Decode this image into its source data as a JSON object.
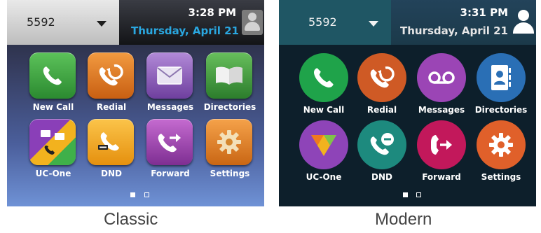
{
  "classic": {
    "line": "5592",
    "time": "3:28 PM",
    "date": "Thursday, April 21",
    "caption": "Classic",
    "colors": {
      "date": "#2aa7e0"
    },
    "apps": [
      {
        "label": "New Call",
        "icon": "phone-icon",
        "color": "#3aa040"
      },
      {
        "label": "Redial",
        "icon": "redial-icon",
        "color": "#e07a22"
      },
      {
        "label": "Messages",
        "icon": "envelope-icon",
        "color": "#8c5fb8"
      },
      {
        "label": "Directories",
        "icon": "book-icon",
        "color": "#3f9a3a"
      },
      {
        "label": "UC-One",
        "icon": "uc-one-icon",
        "color": "#7a3fa8"
      },
      {
        "label": "DND",
        "icon": "dnd-icon",
        "color": "#f0a21a"
      },
      {
        "label": "Forward",
        "icon": "forward-icon",
        "color": "#9a3fa8"
      },
      {
        "label": "Settings",
        "icon": "gear-icon",
        "color": "#e8841e"
      }
    ]
  },
  "modern": {
    "line": "5592",
    "time": "3:31 PM",
    "date": "Thursday, April 21",
    "caption": "Modern",
    "apps": [
      {
        "label": "New Call",
        "icon": "phone-icon",
        "color": "#1fa34a"
      },
      {
        "label": "Redial",
        "icon": "redial-icon",
        "color": "#cf5a25"
      },
      {
        "label": "Messages",
        "icon": "voicemail-icon",
        "color": "#9b45b5"
      },
      {
        "label": "Directories",
        "icon": "contact-book-icon",
        "color": "#2a6fb5"
      },
      {
        "label": "UC-One",
        "icon": "uc-one-icon",
        "color": "#8e44b8"
      },
      {
        "label": "DND",
        "icon": "dnd-icon",
        "color": "#1d8a7e"
      },
      {
        "label": "Forward",
        "icon": "forward-icon",
        "color": "#c2185b"
      },
      {
        "label": "Settings",
        "icon": "gear-icon",
        "color": "#e0602a"
      }
    ]
  }
}
